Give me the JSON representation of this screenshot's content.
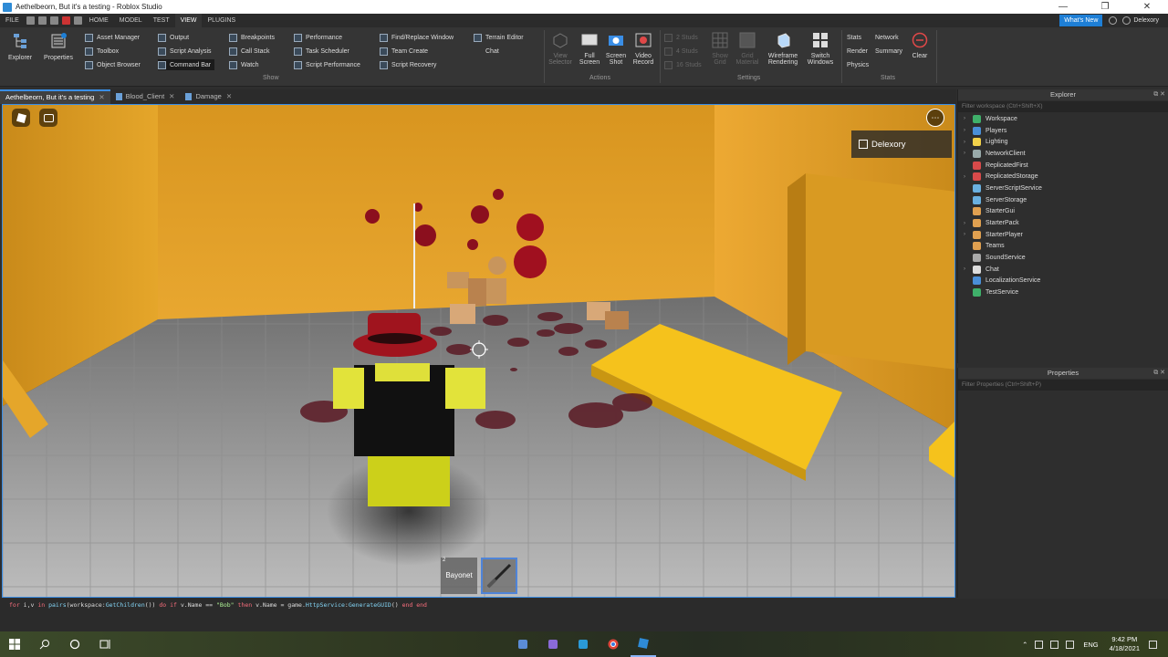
{
  "window": {
    "title": "Aethelbeorn, But it's a testing - Roblox Studio",
    "controls": [
      "—",
      "❐",
      "✕"
    ]
  },
  "menu": {
    "items": [
      "FILE",
      "HOME",
      "MODEL",
      "TEST",
      "VIEW",
      "PLUGINS"
    ],
    "active": "VIEW",
    "whats_new": "What's New",
    "username": "Delexory"
  },
  "ribbon": {
    "explorer": "Explorer",
    "properties": "Properties",
    "show_col1": [
      "Asset Manager",
      "Toolbox",
      "Object Browser"
    ],
    "show_col2": [
      "Output",
      "Script Analysis",
      "Command Bar"
    ],
    "show_col3": [
      "Breakpoints",
      "Call Stack",
      "Watch"
    ],
    "show_col4": [
      "Performance",
      "Task Scheduler",
      "Script Performance"
    ],
    "show_col5": [
      "Find/Replace Window",
      "Team Create",
      "Script Recovery"
    ],
    "show_col6": [
      "Terrain Editor",
      "Chat"
    ],
    "show_label": "Show",
    "actions": {
      "view_selector": "View Selector",
      "full_screen": "Full Screen",
      "screen_shot": "Screen Shot",
      "video_record": "Video Record",
      "label": "Actions"
    },
    "settings": {
      "studs": [
        "2 Studs",
        "4 Studs",
        "16 Studs"
      ],
      "show_grid": "Show Grid",
      "grid_material": "Grid Material",
      "wireframe": "Wireframe Rendering",
      "switch_windows": "Switch Windows",
      "label": "Settings"
    },
    "stats": {
      "items": [
        "Stats",
        "Network",
        "Render",
        "Summary",
        "Physics"
      ],
      "clear": "Clear",
      "label": "Stats"
    }
  },
  "tabs": [
    {
      "label": "Aethelbeorn, But it's a testing"
    },
    {
      "label": "Blood_Client"
    },
    {
      "label": "Damage"
    }
  ],
  "viewport": {
    "player_name": "Delexory",
    "hotbar": [
      {
        "number": "2",
        "label": "Bayonet"
      },
      {
        "number": "",
        "label": ""
      }
    ]
  },
  "explorer": {
    "title": "Explorer",
    "filter_placeholder": "Filter workspace (Ctrl+Shift+X)",
    "items": [
      {
        "label": "Workspace",
        "expandable": true,
        "color": "#3fb06a"
      },
      {
        "label": "Players",
        "expandable": true,
        "color": "#4a8fd8"
      },
      {
        "label": "Lighting",
        "expandable": true,
        "color": "#f2d14a"
      },
      {
        "label": "NetworkClient",
        "expandable": true,
        "color": "#9aa"
      },
      {
        "label": "ReplicatedFirst",
        "expandable": false,
        "color": "#d84a4a"
      },
      {
        "label": "ReplicatedStorage",
        "expandable": true,
        "color": "#d84a4a"
      },
      {
        "label": "ServerScriptService",
        "expandable": false,
        "color": "#6ab0e0"
      },
      {
        "label": "ServerStorage",
        "expandable": false,
        "color": "#6ab0e0"
      },
      {
        "label": "StarterGui",
        "expandable": false,
        "color": "#e0a050"
      },
      {
        "label": "StarterPack",
        "expandable": true,
        "color": "#e0a050"
      },
      {
        "label": "StarterPlayer",
        "expandable": true,
        "color": "#e0a050"
      },
      {
        "label": "Teams",
        "expandable": false,
        "color": "#e0a050"
      },
      {
        "label": "SoundService",
        "expandable": false,
        "color": "#aaa"
      },
      {
        "label": "Chat",
        "expandable": true,
        "color": "#ddd"
      },
      {
        "label": "LocalizationService",
        "expandable": false,
        "color": "#4a8fd8"
      },
      {
        "label": "TestService",
        "expandable": false,
        "color": "#3fb06a"
      }
    ]
  },
  "properties": {
    "title": "Properties",
    "filter_placeholder": "Filter Properties (Ctrl+Shift+P)"
  },
  "command_bar": {
    "parts": [
      {
        "t": "for ",
        "c": "kw"
      },
      {
        "t": "i,v ",
        "c": ""
      },
      {
        "t": "in ",
        "c": "kw"
      },
      {
        "t": "pairs",
        "c": "fn"
      },
      {
        "t": "(workspace:",
        "c": ""
      },
      {
        "t": "GetChildren",
        "c": "fn"
      },
      {
        "t": "()) ",
        "c": ""
      },
      {
        "t": "do if ",
        "c": "kw"
      },
      {
        "t": "v.Name == ",
        "c": ""
      },
      {
        "t": "\"Bob\"",
        "c": "str"
      },
      {
        "t": " then ",
        "c": "kw"
      },
      {
        "t": "v.Name = game.",
        "c": ""
      },
      {
        "t": "HttpService",
        "c": "fn"
      },
      {
        "t": ":",
        "c": ""
      },
      {
        "t": "GenerateGUID",
        "c": "fn"
      },
      {
        "t": "() ",
        "c": ""
      },
      {
        "t": "end end",
        "c": "kw"
      }
    ]
  },
  "taskbar": {
    "lang": "ENG",
    "time": "9:42 PM",
    "date": "4/18/2021"
  }
}
